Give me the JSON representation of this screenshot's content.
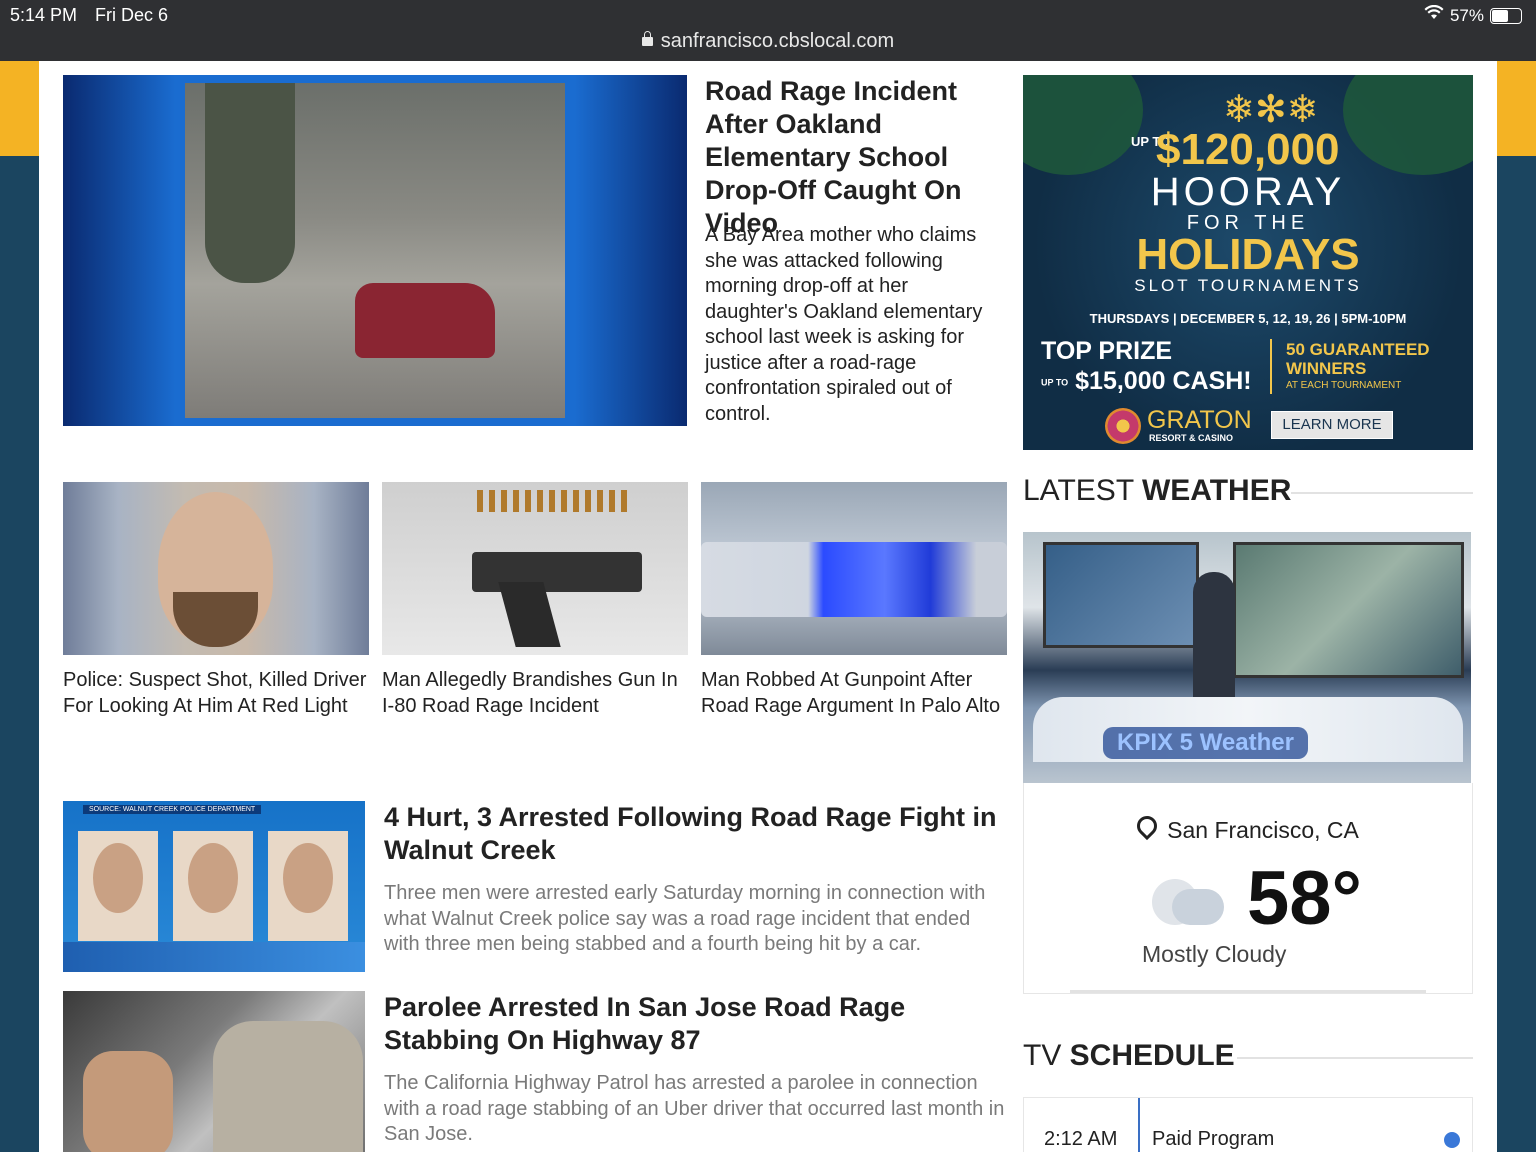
{
  "status_bar": {
    "time": "5:14 PM",
    "date": "Fri Dec 6",
    "battery": "57%",
    "url": "sanfrancisco.cbslocal.com"
  },
  "featured": {
    "title": "Road Rage Incident After Oakland Elementary School Drop-Off Caught On Video",
    "description": "A Bay Area mother who claims she was attacked following morning drop-off at her daughter's Oakland elementary school last week is asking for justice after a road-rage confrontation spiraled out of control."
  },
  "ad": {
    "up_to": "UP TO",
    "prize": "$120,000",
    "hooray": "HOORAY",
    "for_the": "FOR THE",
    "holidays": "HOLIDAYS",
    "slot": "SLOT TOURNAMENTS",
    "dates": "THURSDAYS | DECEMBER 5, 12, 19, 26 | 5PM-10PM",
    "top_prize": "TOP PRIZE",
    "top_prize_value": "$15,000 CASH!",
    "top_prize_upto": "UP TO",
    "guaranteed": "50 GUARANTEED WINNERS",
    "guaranteed_sub": "AT EACH TOURNAMENT",
    "brand": "GRATON",
    "brand_sub": "RESORT & CASINO",
    "cta": "LEARN MORE"
  },
  "cards": [
    {
      "title": "Police: Suspect Shot, Killed Driver For Looking At Him At Red Light"
    },
    {
      "title": "Man Allegedly Brandishes Gun In I-80 Road Rage Incident"
    },
    {
      "title": "Man Robbed At Gunpoint After Road Rage Argument In Palo Alto"
    }
  ],
  "stories": [
    {
      "title": "4 Hurt, 3 Arrested Following Road Rage Fight in Walnut Creek",
      "description": "Three men were arrested early Saturday morning in connection with what Walnut Creek police say was a road rage incident that ended with three men being stabbed and a fourth being hit by a car.",
      "image_caption": "SOURCE: WALNUT CREEK POLICE DEPARTMENT"
    },
    {
      "title": "Parolee Arrested In San Jose Road Rage Stabbing On Highway 87",
      "description": "The California Highway Patrol has arrested a parolee in connection with a road rage stabbing of an Uber driver that occurred last month in San Jose."
    }
  ],
  "weather": {
    "heading_light": "LATEST ",
    "heading_bold": "WEATHER",
    "studio_logo": "KPIX 5 Weather",
    "location": "San Francisco, CA",
    "temperature": "58°",
    "condition": "Mostly Cloudy"
  },
  "tv_schedule": {
    "heading_light": "TV ",
    "heading_bold": "SCHEDULE",
    "time": "2:12 AM",
    "program": "Paid Program"
  }
}
